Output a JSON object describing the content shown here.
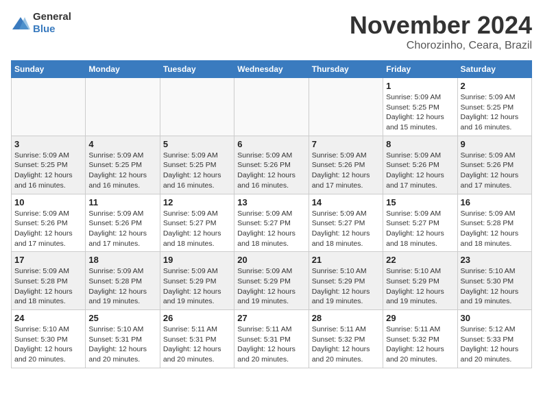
{
  "header": {
    "logo_general": "General",
    "logo_blue": "Blue",
    "month_title": "November 2024",
    "location": "Chorozinho, Ceara, Brazil"
  },
  "days_of_week": [
    "Sunday",
    "Monday",
    "Tuesday",
    "Wednesday",
    "Thursday",
    "Friday",
    "Saturday"
  ],
  "weeks": [
    [
      {
        "day": "",
        "info": ""
      },
      {
        "day": "",
        "info": ""
      },
      {
        "day": "",
        "info": ""
      },
      {
        "day": "",
        "info": ""
      },
      {
        "day": "",
        "info": ""
      },
      {
        "day": "1",
        "info": "Sunrise: 5:09 AM\nSunset: 5:25 PM\nDaylight: 12 hours\nand 15 minutes."
      },
      {
        "day": "2",
        "info": "Sunrise: 5:09 AM\nSunset: 5:25 PM\nDaylight: 12 hours\nand 16 minutes."
      }
    ],
    [
      {
        "day": "3",
        "info": "Sunrise: 5:09 AM\nSunset: 5:25 PM\nDaylight: 12 hours\nand 16 minutes."
      },
      {
        "day": "4",
        "info": "Sunrise: 5:09 AM\nSunset: 5:25 PM\nDaylight: 12 hours\nand 16 minutes."
      },
      {
        "day": "5",
        "info": "Sunrise: 5:09 AM\nSunset: 5:25 PM\nDaylight: 12 hours\nand 16 minutes."
      },
      {
        "day": "6",
        "info": "Sunrise: 5:09 AM\nSunset: 5:26 PM\nDaylight: 12 hours\nand 16 minutes."
      },
      {
        "day": "7",
        "info": "Sunrise: 5:09 AM\nSunset: 5:26 PM\nDaylight: 12 hours\nand 17 minutes."
      },
      {
        "day": "8",
        "info": "Sunrise: 5:09 AM\nSunset: 5:26 PM\nDaylight: 12 hours\nand 17 minutes."
      },
      {
        "day": "9",
        "info": "Sunrise: 5:09 AM\nSunset: 5:26 PM\nDaylight: 12 hours\nand 17 minutes."
      }
    ],
    [
      {
        "day": "10",
        "info": "Sunrise: 5:09 AM\nSunset: 5:26 PM\nDaylight: 12 hours\nand 17 minutes."
      },
      {
        "day": "11",
        "info": "Sunrise: 5:09 AM\nSunset: 5:26 PM\nDaylight: 12 hours\nand 17 minutes."
      },
      {
        "day": "12",
        "info": "Sunrise: 5:09 AM\nSunset: 5:27 PM\nDaylight: 12 hours\nand 18 minutes."
      },
      {
        "day": "13",
        "info": "Sunrise: 5:09 AM\nSunset: 5:27 PM\nDaylight: 12 hours\nand 18 minutes."
      },
      {
        "day": "14",
        "info": "Sunrise: 5:09 AM\nSunset: 5:27 PM\nDaylight: 12 hours\nand 18 minutes."
      },
      {
        "day": "15",
        "info": "Sunrise: 5:09 AM\nSunset: 5:27 PM\nDaylight: 12 hours\nand 18 minutes."
      },
      {
        "day": "16",
        "info": "Sunrise: 5:09 AM\nSunset: 5:28 PM\nDaylight: 12 hours\nand 18 minutes."
      }
    ],
    [
      {
        "day": "17",
        "info": "Sunrise: 5:09 AM\nSunset: 5:28 PM\nDaylight: 12 hours\nand 18 minutes."
      },
      {
        "day": "18",
        "info": "Sunrise: 5:09 AM\nSunset: 5:28 PM\nDaylight: 12 hours\nand 19 minutes."
      },
      {
        "day": "19",
        "info": "Sunrise: 5:09 AM\nSunset: 5:29 PM\nDaylight: 12 hours\nand 19 minutes."
      },
      {
        "day": "20",
        "info": "Sunrise: 5:09 AM\nSunset: 5:29 PM\nDaylight: 12 hours\nand 19 minutes."
      },
      {
        "day": "21",
        "info": "Sunrise: 5:10 AM\nSunset: 5:29 PM\nDaylight: 12 hours\nand 19 minutes."
      },
      {
        "day": "22",
        "info": "Sunrise: 5:10 AM\nSunset: 5:29 PM\nDaylight: 12 hours\nand 19 minutes."
      },
      {
        "day": "23",
        "info": "Sunrise: 5:10 AM\nSunset: 5:30 PM\nDaylight: 12 hours\nand 19 minutes."
      }
    ],
    [
      {
        "day": "24",
        "info": "Sunrise: 5:10 AM\nSunset: 5:30 PM\nDaylight: 12 hours\nand 20 minutes."
      },
      {
        "day": "25",
        "info": "Sunrise: 5:10 AM\nSunset: 5:31 PM\nDaylight: 12 hours\nand 20 minutes."
      },
      {
        "day": "26",
        "info": "Sunrise: 5:11 AM\nSunset: 5:31 PM\nDaylight: 12 hours\nand 20 minutes."
      },
      {
        "day": "27",
        "info": "Sunrise: 5:11 AM\nSunset: 5:31 PM\nDaylight: 12 hours\nand 20 minutes."
      },
      {
        "day": "28",
        "info": "Sunrise: 5:11 AM\nSunset: 5:32 PM\nDaylight: 12 hours\nand 20 minutes."
      },
      {
        "day": "29",
        "info": "Sunrise: 5:11 AM\nSunset: 5:32 PM\nDaylight: 12 hours\nand 20 minutes."
      },
      {
        "day": "30",
        "info": "Sunrise: 5:12 AM\nSunset: 5:33 PM\nDaylight: 12 hours\nand 20 minutes."
      }
    ]
  ]
}
